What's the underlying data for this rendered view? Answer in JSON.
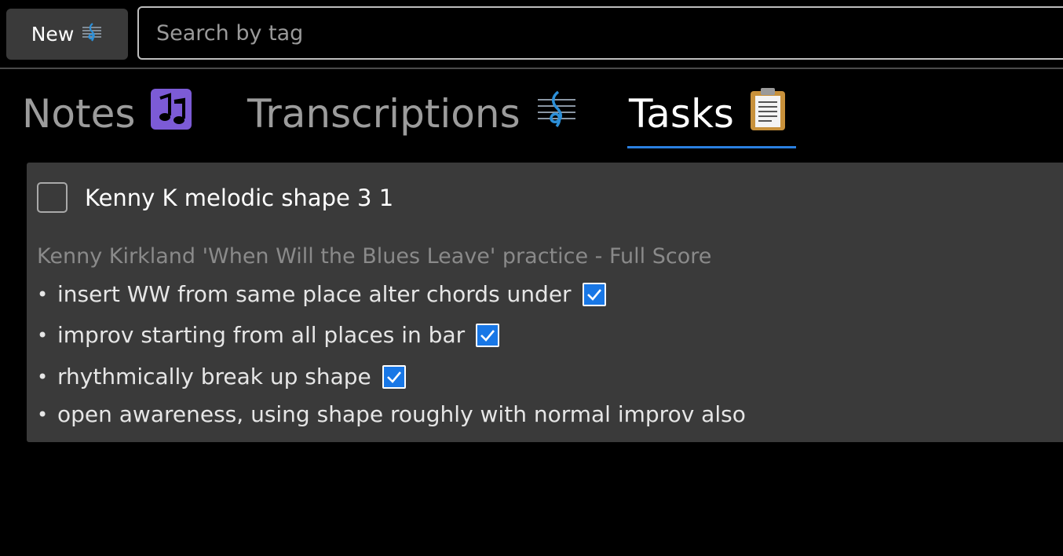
{
  "toolbar": {
    "new_label": "New",
    "search_placeholder": "Search by tag"
  },
  "tabs": [
    {
      "label": "Notes",
      "icon": "musical-notes-icon",
      "active": false
    },
    {
      "label": "Transcriptions",
      "icon": "treble-clef-score-icon",
      "active": false
    },
    {
      "label": "Tasks",
      "icon": "clipboard-icon",
      "active": true
    }
  ],
  "task": {
    "title": "Kenny K melodic shape 3 1",
    "completed": false,
    "subtitle": "Kenny Kirkland 'When Will the Blues Leave' practice - Full Score",
    "bullets": [
      {
        "dot": "•",
        "text": "insert WW from same place alter chords under",
        "checked": true
      },
      {
        "dot": "•",
        "text": "improv starting from all places in bar",
        "checked": true
      },
      {
        "dot": "•",
        "text": "rhythmically break up shape",
        "checked": true
      },
      {
        "dot": "•",
        "text": "open awareness, using shape roughly with normal improv also",
        "checked": null
      }
    ]
  },
  "colors": {
    "accent": "#2a7fe0",
    "card_bg": "#3a3a3a",
    "checkbox_checked": "#1877e6",
    "notes_icon": "#7c5bd6",
    "clef_icon": "#2c8fd8"
  }
}
